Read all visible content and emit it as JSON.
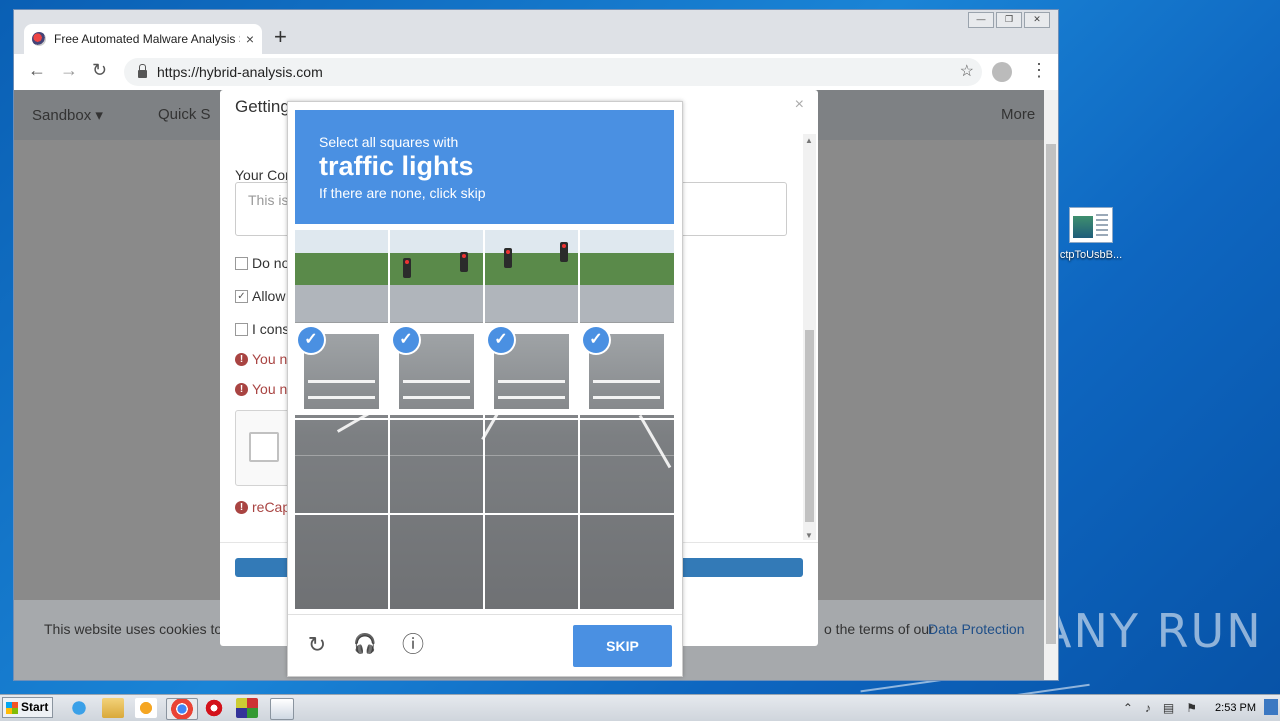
{
  "browser": {
    "tab_title": "Free Automated Malware Analysis S",
    "tab_close": "×",
    "new_tab": "+",
    "url": "https://hybrid-analysis.com",
    "back": "←",
    "forward": "→",
    "reload": "↻",
    "star": "☆",
    "menu": "⋮",
    "caption": {
      "minimize": "—",
      "restore": "❐",
      "close": "✕"
    }
  },
  "site_nav": {
    "sandbox": "Sandbox ▾",
    "quick": "Quick S",
    "more": "More"
  },
  "modal": {
    "title": "Getting",
    "close": "×",
    "comment_label": "Your Con",
    "comment_placeholder": "This is",
    "checkboxes": [
      {
        "label": "Do no",
        "checked": false
      },
      {
        "label": "Allow",
        "checked": true
      },
      {
        "label": "I cons",
        "checked": false
      }
    ],
    "errors": [
      "You n",
      "You n"
    ],
    "recaptcha_error": "reCap"
  },
  "cookie_bar": {
    "text_left": "This website uses cookies to",
    "text_right": "o the terms of our",
    "link": "Data Protection"
  },
  "captcha": {
    "line1": "Select all squares with",
    "line2": "traffic lights",
    "line3": "If there are none, click skip",
    "selected_tiles": [
      1,
      2,
      3,
      4
    ],
    "check_glyph": "✓",
    "icons": {
      "reload": "reload-icon",
      "audio": "headphones-icon",
      "info": "info-icon"
    },
    "icon_glyphs": {
      "reload": "↻",
      "audio": "🎧",
      "info": "ⓘ"
    },
    "skip_label": "SKIP"
  },
  "desktop": {
    "icon_label": "ctpToUsbB...",
    "watermark": "ANY RUN"
  },
  "taskbar": {
    "start": "Start",
    "clock": "2:53 PM",
    "tray_up": "⌃"
  }
}
